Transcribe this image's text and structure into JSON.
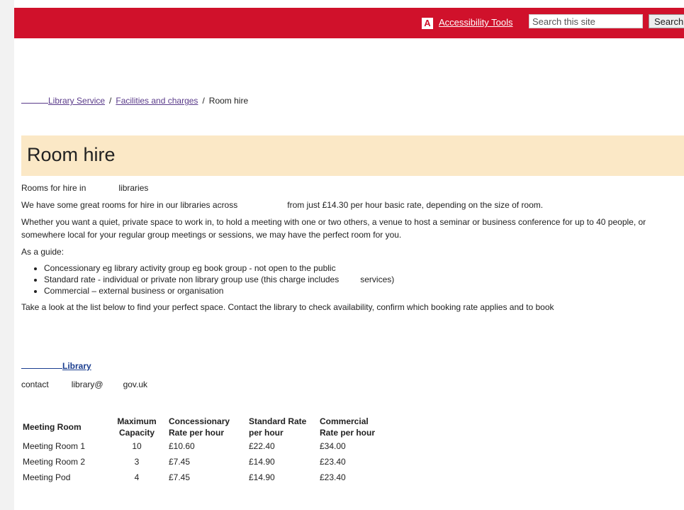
{
  "header": {
    "accessibility_badge": "A",
    "accessibility_label": "Accessibility Tools",
    "search_placeholder": "Search this site",
    "search_button": "Search"
  },
  "breadcrumb": {
    "items": [
      "Library Service",
      "Facilities and charges"
    ],
    "current": "Room hire",
    "separator": "/"
  },
  "page_title": "Room hire",
  "intro": {
    "p1_start": "Rooms for hire in",
    "p1_end": "libraries",
    "p2_start": "We have some great rooms for hire in our libraries across",
    "p2_end": "from just £14.30 per hour basic rate, depending on the size of room.",
    "p3": "Whether you want a quiet, private space to work in, to hold a meeting with one or two others, a venue to host a seminar or business conference for up to 40 people, or somewhere local for your regular group meetings or sessions, we may have the perfect room for you.",
    "p4": "As a guide:"
  },
  "guide_items": [
    "Concessionary eg library activity group eg book group  - not open to the public",
    "Standard rate - individual or private non library group use (this charge includes",
    "Commercial – external business or organisation"
  ],
  "guide_item2_tail": "services)",
  "closing": "Take a look at the list below to find your perfect space. Contact the library to check availability, confirm which booking rate applies and to book",
  "library": {
    "name": "Library",
    "contact_label": "contact",
    "email_start": "library@",
    "email_end": "gov.uk"
  },
  "table": {
    "headers": [
      "Meeting Room",
      "Maximum Capacity",
      "Concessionary Rate per hour",
      "Standard Rate per hour",
      "Commercial Rate per hour"
    ],
    "header_lines": [
      [
        "Meeting Room"
      ],
      [
        "Maximum",
        "Capacity"
      ],
      [
        "Concessionary",
        "Rate per hour"
      ],
      [
        "Standard Rate",
        "per hour"
      ],
      [
        "Commercial",
        "Rate per hour"
      ]
    ],
    "rows": [
      [
        "Meeting Room 1",
        "10",
        "£10.60",
        "£22.40",
        "£34.00"
      ],
      [
        "Meeting Room 2",
        "3",
        "£7.45",
        "£14.90",
        "£23.40"
      ],
      [
        "Meeting Pod",
        "4",
        "£7.45",
        "£14.90",
        "£23.40"
      ]
    ]
  },
  "colors": {
    "header_red": "#d0112b",
    "title_band": "#fbe8c6",
    "link_purple": "#5a3b8a",
    "link_blue": "#1a3d8f"
  }
}
